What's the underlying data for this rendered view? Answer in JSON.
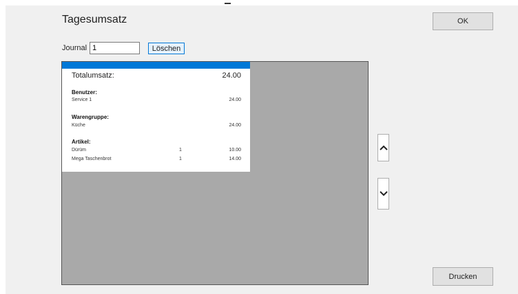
{
  "window": {
    "title": "Tagesumsatz"
  },
  "buttons": {
    "ok": "OK",
    "print": "Drucken",
    "clear": "Löschen"
  },
  "journal": {
    "label": "Journal",
    "value": "1"
  },
  "receipt": {
    "total_label": "Totalumsatz:",
    "total_value": "24.00",
    "users_heading": "Benutzer:",
    "user_name": "Service 1",
    "user_amount": "24.00",
    "group_heading": "Warengruppe:",
    "group_name": "Küche",
    "group_amount": "24.00",
    "articles_heading": "Artikel:",
    "articles": [
      {
        "name": "Dürüm",
        "qty": "1",
        "amount": "10.00"
      },
      {
        "name": "Mega Taschenbrot",
        "qty": "1",
        "amount": "14.00"
      }
    ]
  },
  "icons": {
    "scroll_up": "chevron-up-icon",
    "scroll_down": "chevron-down-icon"
  },
  "colors": {
    "accent": "#0078d7",
    "report_bg": "#a9a9a9",
    "window_bg": "#f0f0f0"
  }
}
